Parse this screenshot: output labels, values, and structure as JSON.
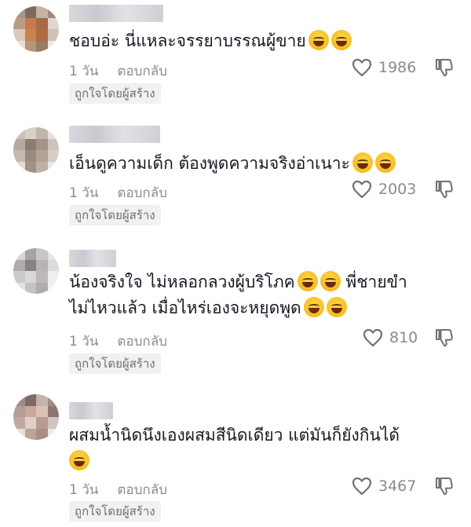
{
  "comments": [
    {
      "text": "ชอบอ่ะ นี่แหละจรรยาบรรณผู้ขาย",
      "emoji_count": 2,
      "time": "1 วัน",
      "reply_label": "ตอบกลับ",
      "likes": "1986",
      "creator_badge": "ถูกใจโดยผู้สร้าง"
    },
    {
      "text": "เอ็นดูความเด็ก ต้องพูดความจริงอ่าเนาะ",
      "emoji_count": 2,
      "time": "1 วัน",
      "reply_label": "ตอบกลับ",
      "likes": "2003",
      "creator_badge": "ถูกใจโดยผู้สร้าง"
    },
    {
      "text_line1": "น้องจริงใจ ไม่หลอกลวงผู้บริโภค",
      "text_line1_tail": " พี่ชายขำ",
      "text_line2": "ไม่ไหวแล้ว เมื่อไหร่เองจะหยุดพูด",
      "time": "1 วัน",
      "reply_label": "ตอบกลับ",
      "likes": "810",
      "creator_badge": "ถูกใจโดยผู้สร้าง"
    },
    {
      "text": "ผสมน้ำนิดนึงเองผสมสีนิดเดียว แต่มันก็ยังกินได้",
      "emoji_count": 1,
      "time": "1 วัน",
      "reply_label": "ตอบกลับ",
      "likes": "3467",
      "creator_badge": "ถูกใจโดยผู้สร้าง"
    }
  ],
  "icons": {
    "like": "heart-outline-icon",
    "dislike": "thumbs-down-icon",
    "emoji": "tears-of-joy-emoji"
  },
  "colors": {
    "text": "#161823",
    "meta": "#8a8b91",
    "badge_bg": "#f1f1f2"
  }
}
